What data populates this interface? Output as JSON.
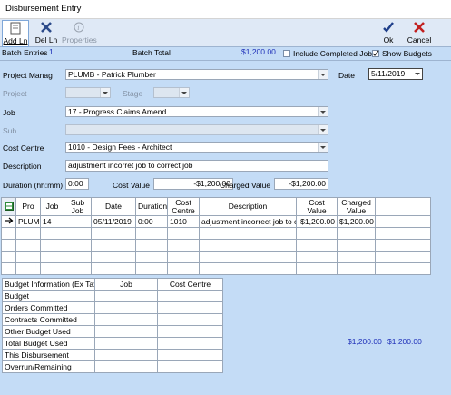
{
  "window": {
    "title": "Disbursement Entry"
  },
  "toolbar": {
    "add_line": "Add Ln",
    "del_line": "Del Ln",
    "properties": "Properties",
    "ok": "Ok",
    "cancel": "Cancel"
  },
  "batch": {
    "entries_label": "Batch Entries",
    "entries_value": "1",
    "total_label": "Batch Total",
    "total_value": "$1,200.00",
    "include_completed": "Include Completed Jobs",
    "show_budgets": "Show Budgets",
    "show_budgets_checked": true,
    "include_completed_checked": false
  },
  "form": {
    "project_label": "Project Manag",
    "project_value": "PLUMB - Patrick  Plumber",
    "date_label": "Date",
    "date_value": "5/11/2019",
    "project2_label": "Project",
    "stage_label": "Stage",
    "job_label": "Job",
    "job_value": "17 - Progress Claims Amend",
    "sub_label": "Sub",
    "cost_centre_label": "Cost Centre",
    "cost_centre_value": "1010 - Design Fees - Architect",
    "description_label": "Description",
    "description_value": "adjustment incorret job to correct job",
    "duration_label": "Duration (hh:mm)",
    "duration_value": "0:00",
    "cost_value_label": "Cost Value",
    "cost_value": "-$1,200.00",
    "charged_value_label": "Charged Value",
    "charged_value": "-$1,200.00"
  },
  "grid": {
    "headers": [
      "Pro",
      "Job",
      "Sub Job",
      "Date",
      "Duration",
      "Cost Centre",
      "Description",
      "Cost Value",
      "Charged Value"
    ],
    "row": [
      "PLUMB",
      "14",
      "",
      "05/11/2019",
      "0:00",
      "1010",
      "adjustment incorrect job to cor",
      "$1,200.00",
      "$1,200.00"
    ]
  },
  "budget": {
    "col_info": "Budget Information (Ex Tax)",
    "col_job": "Job",
    "col_cc": "Cost Centre",
    "rows": [
      "Budget",
      "Orders Committed",
      "Contracts Committed",
      "Other Budget Used",
      "Total Budget Used",
      "This Disbursement",
      "Overrun/Remaining"
    ]
  },
  "totals": {
    "cost": "$1,200.00",
    "charged": "$1,200.00"
  }
}
